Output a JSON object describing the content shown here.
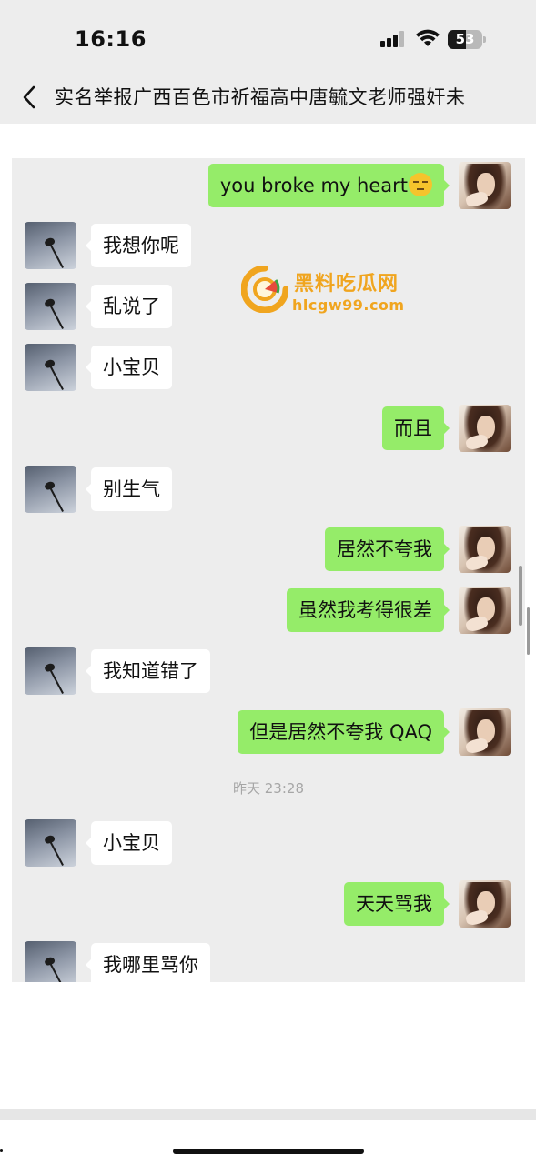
{
  "status_bar": {
    "time": "16:16",
    "battery_level": "53",
    "signal_icon": "cellular-signal-icon",
    "wifi_icon": "wifi-icon",
    "battery_icon": "battery-icon"
  },
  "nav": {
    "title": "实名举报广西百色市祈福高中唐毓文老师强奸未",
    "back_icon": "chevron-left-icon"
  },
  "watermark": {
    "title": "黑料吃瓜网",
    "url": "hlcgw99.com"
  },
  "messages": [
    {
      "side": "right",
      "text": "you broke my heart",
      "emoji": "pensive-face-icon"
    },
    {
      "side": "left",
      "text": "我想你呢"
    },
    {
      "side": "left",
      "text": "乱说了"
    },
    {
      "side": "left",
      "text": "小宝贝"
    },
    {
      "side": "right",
      "text": "而且"
    },
    {
      "side": "left",
      "text": "别生气"
    },
    {
      "side": "right",
      "text": "居然不夸我"
    },
    {
      "side": "right",
      "text": "虽然我考得很差"
    },
    {
      "side": "left",
      "text": "我知道错了"
    },
    {
      "side": "right",
      "text": "但是居然不夸我 QAQ"
    },
    {
      "side": "left",
      "text": "小宝贝"
    },
    {
      "side": "right",
      "text": "天天骂我"
    },
    {
      "side": "left",
      "text": "我哪里骂你"
    }
  ],
  "timestamp": "昨天 23:28",
  "colors": {
    "chat_background": "#ededed",
    "sent_bubble": "#95ec69",
    "received_bubble": "#ffffff",
    "watermark": "#f0a51f"
  }
}
